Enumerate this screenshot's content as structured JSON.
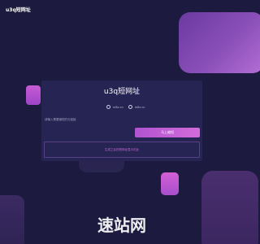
{
  "header": {
    "logo_text": "u3q短网址"
  },
  "main": {
    "title": "u3q短网址",
    "radio_options": [
      {
        "label": "m8z.cn"
      },
      {
        "label": "m8z.cn"
      }
    ],
    "url_input": {
      "placeholder": "请输入需要缩短的长链接",
      "value": ""
    },
    "submit_button_label": "马上缩短",
    "result_text": "生成之后的短网址显示在此"
  },
  "watermark": {
    "text": "速站网"
  },
  "colors": {
    "background": "#1c1a3e",
    "card": "#262452",
    "accent": "#c25ed5",
    "result_text": "#c46bd6"
  }
}
